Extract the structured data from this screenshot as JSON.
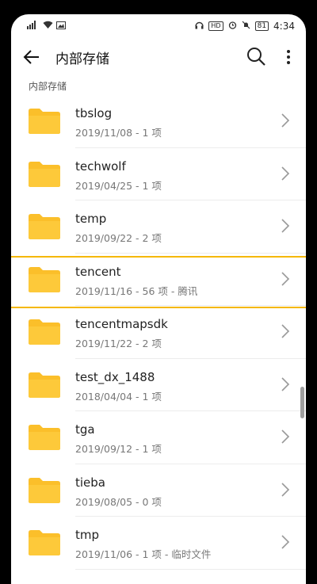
{
  "status_bar": {
    "left_icons": [
      "signal-icon",
      "wifi-icon",
      "image-icon"
    ],
    "hd": "HD",
    "battery": "81",
    "time": "4:34"
  },
  "header": {
    "title": "内部存储",
    "breadcrumb": "内部存储"
  },
  "accent_color": "#f5b800",
  "folder_color": "#fbbf2a",
  "folders": [
    {
      "name": "tbslog",
      "meta": "2019/11/08 - 1 项"
    },
    {
      "name": "techwolf",
      "meta": "2019/04/25 - 1 项"
    },
    {
      "name": "temp",
      "meta": "2019/09/22 - 2 项"
    },
    {
      "name": "tencent",
      "meta": "2019/11/16 - 56 项 - 腾讯"
    },
    {
      "name": "tencentmapsdk",
      "meta": "2019/11/22 - 2 项"
    },
    {
      "name": "test_dx_1488",
      "meta": "2018/04/04 - 1 项"
    },
    {
      "name": "tga",
      "meta": "2019/09/12 - 1 项"
    },
    {
      "name": "tieba",
      "meta": "2019/08/05 - 0 项"
    },
    {
      "name": "tmp",
      "meta": "2019/11/06 - 1 项 - 临时文件"
    }
  ]
}
